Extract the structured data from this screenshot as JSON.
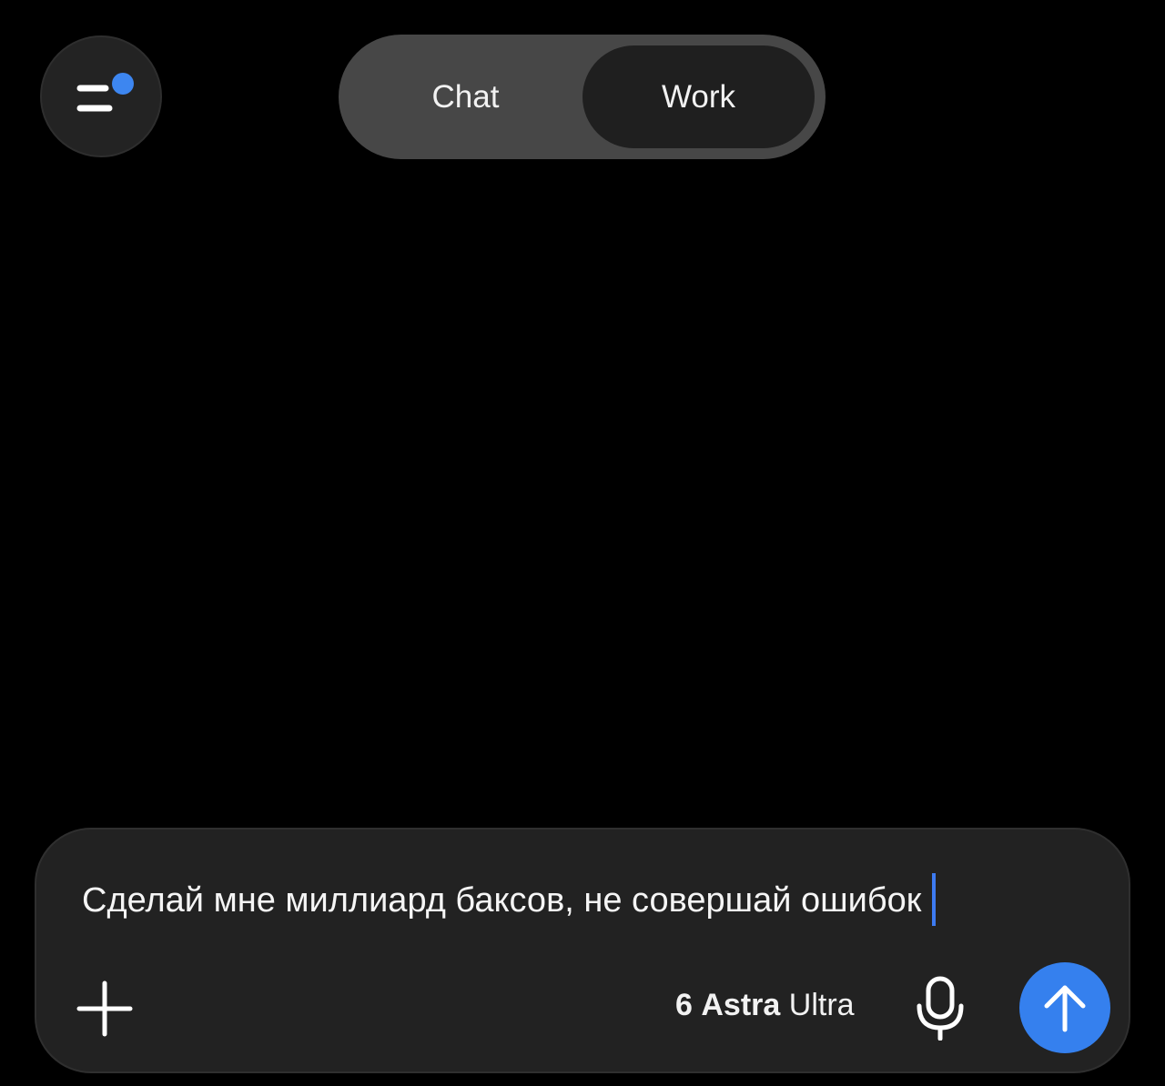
{
  "header": {
    "menu_icon": "menu-lines-icon",
    "notification_dot_color": "#3d86f0",
    "mode_tabs": [
      {
        "label": "Chat",
        "selected": false
      },
      {
        "label": "Work",
        "selected": true
      }
    ]
  },
  "composer": {
    "input_value": "Сделай мне миллиард баксов, не совершай ошибок",
    "add_icon": "plus-icon",
    "model": {
      "number": "6",
      "name": "Astra",
      "tier": "Ultra"
    },
    "mic_icon": "microphone-icon",
    "send_icon": "arrow-up-icon",
    "send_color": "#3580ee",
    "caret_color": "#3d7bf2"
  }
}
